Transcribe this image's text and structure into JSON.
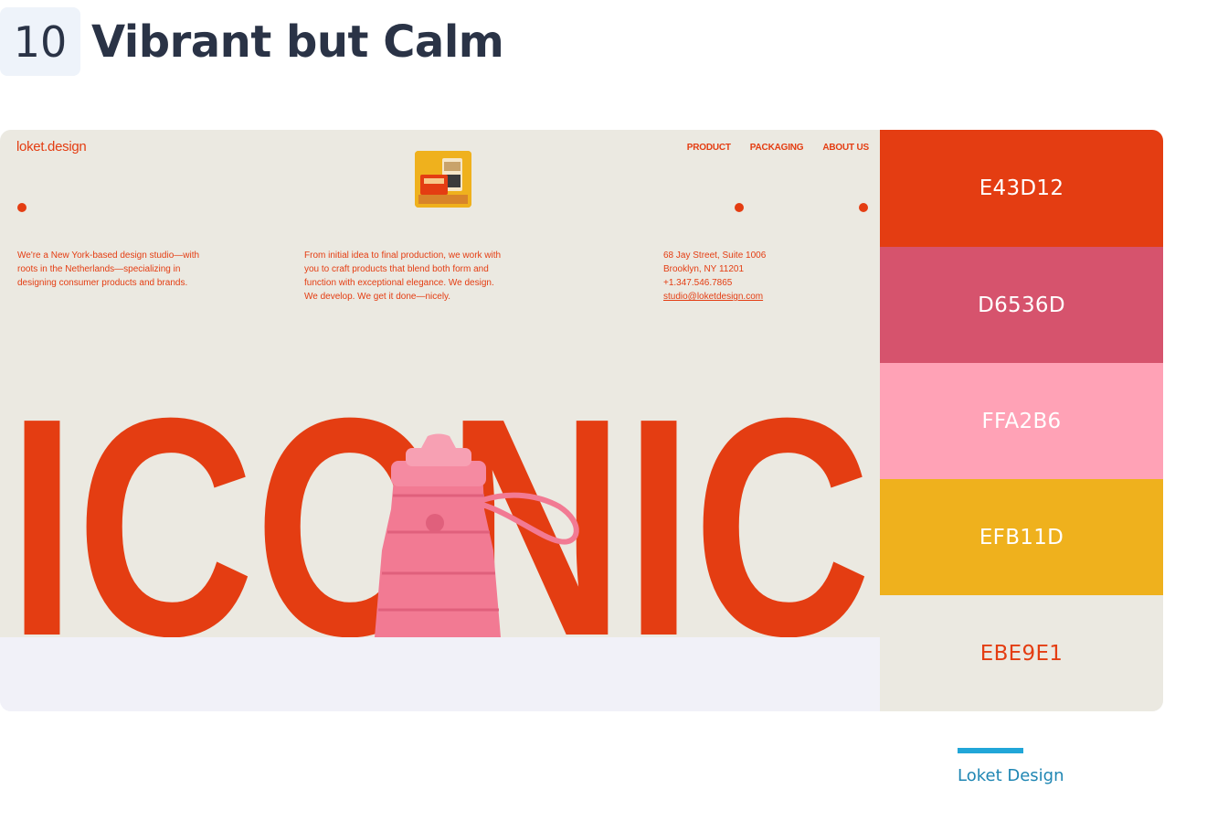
{
  "heading": {
    "number": "10",
    "title": "Vibrant but Calm"
  },
  "preview": {
    "logo": "loket.design",
    "nav": [
      "PRODUCT",
      "PACKAGING",
      "ABOUT US"
    ],
    "intro_lines": [
      "We're a New York-based design studio—with",
      "roots in the Netherlands—specializing in",
      "designing consumer products and brands."
    ],
    "process_lines": [
      "From initial idea to final production, we work with",
      "you to craft products that blend both form and",
      "function with exceptional elegance. We design.",
      "We develop. We get it done—nicely."
    ],
    "contact_lines": [
      "68 Jay Street, Suite 1006",
      "Brooklyn, NY 11201",
      "+1.347.546.7865"
    ],
    "contact_email": "studio@loketdesign.com",
    "hero_word": "ICONIC",
    "colors": {
      "accent": "#E43D12",
      "background": "#EBE9E1",
      "bottle": "#F27A93"
    }
  },
  "palette": [
    {
      "hex": "E43D12",
      "color": "#E43D12",
      "text_color": "#FFFFFF"
    },
    {
      "hex": "D6536D",
      "color": "#D6536D",
      "text_color": "#FFFFFF"
    },
    {
      "hex": "FFA2B6",
      "color": "#FFA2B6",
      "text_color": "#FFFFFF"
    },
    {
      "hex": "EFB11D",
      "color": "#EFB11D",
      "text_color": "#FFFFFF"
    },
    {
      "hex": "EBE9E1",
      "color": "#EBE9E1",
      "text_color": "#E43D12"
    }
  ],
  "credit": {
    "label": "Loket Design"
  }
}
